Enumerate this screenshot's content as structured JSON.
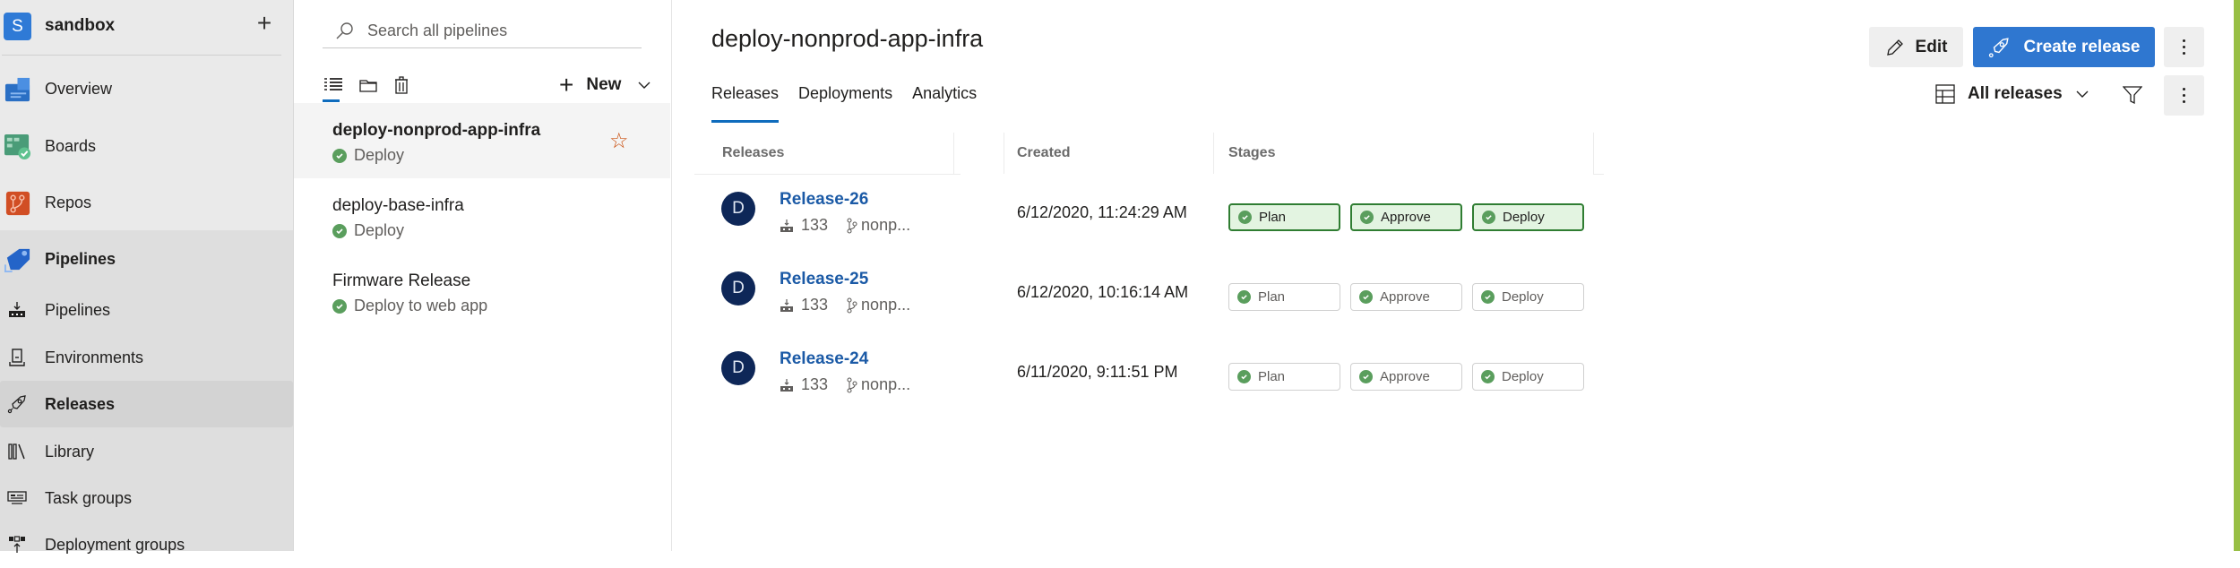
{
  "sidebar": {
    "project": {
      "initial": "S",
      "name": "sandbox",
      "add_icon": "plus-icon"
    },
    "nav": [
      {
        "label": "Overview",
        "icon": "overview-icon"
      },
      {
        "label": "Boards",
        "icon": "boards-icon"
      },
      {
        "label": "Repos",
        "icon": "repos-icon"
      },
      {
        "label": "Pipelines",
        "icon": "pipelines-rocket-icon"
      }
    ],
    "sub_nav": [
      {
        "label": "Pipelines",
        "icon": "pipelines-icon"
      },
      {
        "label": "Environments",
        "icon": "environments-icon"
      },
      {
        "label": "Releases",
        "icon": "rocket-icon",
        "selected": true
      },
      {
        "label": "Library",
        "icon": "library-icon"
      },
      {
        "label": "Task groups",
        "icon": "task-groups-icon"
      },
      {
        "label": "Deployment groups",
        "icon": "deployment-groups-icon"
      }
    ]
  },
  "list_pane": {
    "search_placeholder": "Search all pipelines",
    "new_label": "New",
    "pipelines": [
      {
        "name": "deploy-nonprod-app-infra",
        "stage": "Deploy",
        "selected": true,
        "favorite": true
      },
      {
        "name": "deploy-base-infra",
        "stage": "Deploy"
      },
      {
        "name": "Firmware Release",
        "stage": "Deploy to web app"
      }
    ]
  },
  "main": {
    "title": "deploy-nonprod-app-infra",
    "tabs": [
      {
        "label": "Releases",
        "active": true
      },
      {
        "label": "Deployments"
      },
      {
        "label": "Analytics"
      }
    ],
    "edit_label": "Edit",
    "create_label": "Create release",
    "view_label": "All releases",
    "columns": {
      "releases": "Releases",
      "created": "Created",
      "stages": "Stages"
    },
    "releases": [
      {
        "avatar": "D",
        "name": "Release-26",
        "build": "133",
        "branch": "nonp...",
        "created": "6/12/2020, 11:24:29 AM",
        "stages": [
          {
            "name": "Plan",
            "status": "succeeded"
          },
          {
            "name": "Approve",
            "status": "succeeded"
          },
          {
            "name": "Deploy",
            "status": "succeeded"
          }
        ],
        "current": true
      },
      {
        "avatar": "D",
        "name": "Release-25",
        "build": "133",
        "branch": "nonp...",
        "created": "6/12/2020, 10:16:14 AM",
        "stages": [
          {
            "name": "Plan",
            "status": "succeeded"
          },
          {
            "name": "Approve",
            "status": "succeeded"
          },
          {
            "name": "Deploy",
            "status": "succeeded"
          }
        ]
      },
      {
        "avatar": "D",
        "name": "Release-24",
        "build": "133",
        "branch": "nonp...",
        "created": "6/11/2020, 9:11:51 PM",
        "stages": [
          {
            "name": "Plan",
            "status": "succeeded"
          },
          {
            "name": "Approve",
            "status": "succeeded"
          },
          {
            "name": "Deploy",
            "status": "succeeded"
          }
        ]
      }
    ]
  },
  "colors": {
    "accent": "#2f77d0",
    "success": "#5a9e5d",
    "success_border": "#2f7d32",
    "success_bg": "#e3f4e1",
    "link": "#1b5aa6",
    "right_accent": "#98bf45"
  }
}
